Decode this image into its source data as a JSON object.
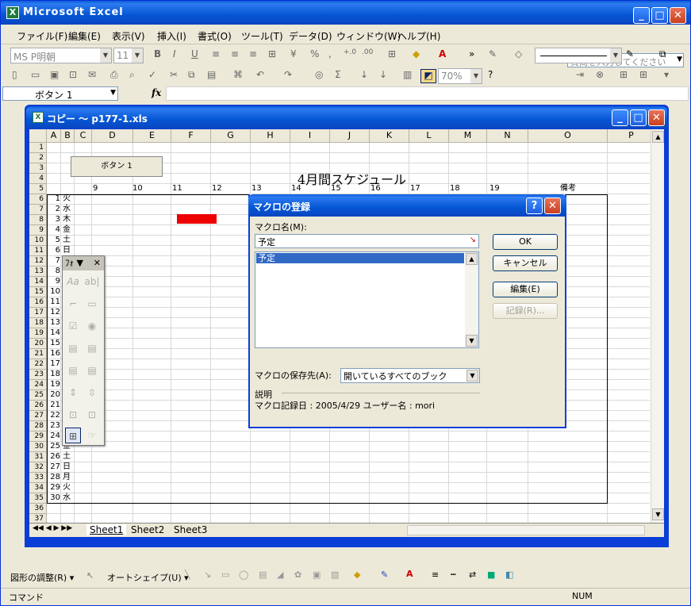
{
  "app": {
    "title": "Microsoft Excel",
    "min": "_",
    "max": "□",
    "close": "✕"
  },
  "menu": [
    "ファイル(F)",
    "編集(E)",
    "表示(V)",
    "挿入(I)",
    "書式(O)",
    "ツール(T)",
    "データ(D)",
    "ウィンドウ(W)",
    "ヘルプ(H)"
  ],
  "help_box": {
    "placeholder": "質問を入力してください"
  },
  "format_toolbar": {
    "font": "MS P明朝",
    "size": "11",
    "bold": "B",
    "italic": "I",
    "underline": "U"
  },
  "standard_toolbar": {
    "zoom": "70%"
  },
  "formula_bar": {
    "name_box": "ボタン 1",
    "fx": "fx"
  },
  "workbook": {
    "title": "コピー ～ p177-1.xls",
    "columns": [
      "A",
      "B",
      "C",
      "D",
      "E",
      "F",
      "G",
      "H",
      "I",
      "J",
      "K",
      "L",
      "M",
      "N",
      "O",
      "P"
    ],
    "rows": [
      "1",
      "2",
      "3",
      "4",
      "5",
      "6",
      "7",
      "8",
      "9",
      "10",
      "11",
      "12",
      "13",
      "14",
      "15",
      "16",
      "17",
      "18",
      "19",
      "20",
      "21",
      "22",
      "23",
      "24",
      "25",
      "26",
      "27",
      "28",
      "29",
      "30",
      "31",
      "32",
      "33",
      "34",
      "35",
      "36",
      "37"
    ],
    "form_button": "ボタン 1",
    "heading": "4月間スケジュール",
    "hours": [
      "9",
      "10",
      "11",
      "12",
      "13",
      "14",
      "15",
      "16",
      "17",
      "18",
      "19"
    ],
    "note_header": "備考",
    "day_rows": [
      {
        "d": "1",
        "w": "火"
      },
      {
        "d": "2",
        "w": "水"
      },
      {
        "d": "3",
        "w": "木"
      },
      {
        "d": "4",
        "w": "金"
      },
      {
        "d": "5",
        "w": "土"
      },
      {
        "d": "6",
        "w": "日"
      },
      {
        "d": "7",
        "w": ""
      },
      {
        "d": "8",
        "w": ""
      },
      {
        "d": "9",
        "w": ""
      },
      {
        "d": "10",
        "w": ""
      },
      {
        "d": "11",
        "w": ""
      },
      {
        "d": "12",
        "w": ""
      },
      {
        "d": "13",
        "w": ""
      },
      {
        "d": "14",
        "w": ""
      },
      {
        "d": "15",
        "w": ""
      },
      {
        "d": "16",
        "w": ""
      },
      {
        "d": "17",
        "w": ""
      },
      {
        "d": "18",
        "w": ""
      },
      {
        "d": "19",
        "w": ""
      },
      {
        "d": "20",
        "w": ""
      },
      {
        "d": "21",
        "w": ""
      },
      {
        "d": "22",
        "w": ""
      },
      {
        "d": "23",
        "w": ""
      },
      {
        "d": "24",
        "w": ""
      },
      {
        "d": "25",
        "w": "金"
      },
      {
        "d": "26",
        "w": "土"
      },
      {
        "d": "27",
        "w": "日"
      },
      {
        "d": "28",
        "w": "月"
      },
      {
        "d": "29",
        "w": "火"
      },
      {
        "d": "30",
        "w": "水"
      }
    ],
    "tabs": [
      "Sheet1",
      "Sheet2",
      "Sheet3"
    ],
    "highlight_color": "#ee0000"
  },
  "forms_toolbar": {
    "title": "ﾌｫ"
  },
  "dialog": {
    "title": "マクロの登録",
    "name_label": "マクロ名(M):",
    "name_value": "予定",
    "list": [
      "予定"
    ],
    "ok": "OK",
    "cancel": "キャンセル",
    "edit": "編集(E)",
    "record": "記録(R)...",
    "store_label": "マクロの保存先(A):",
    "store_value": "開いているすべてのブック",
    "desc_label": "説明",
    "desc_text": "マクロ記録日 : 2005/4/29  ユーザー名 : mori",
    "help": "?",
    "close": "✕"
  },
  "drawing_toolbar": {
    "draw": "図形の調整(R) ▾",
    "autoshape": "オートシェイプ(U) ▾"
  },
  "status": {
    "mode": "コマンド",
    "num": "NUM"
  }
}
